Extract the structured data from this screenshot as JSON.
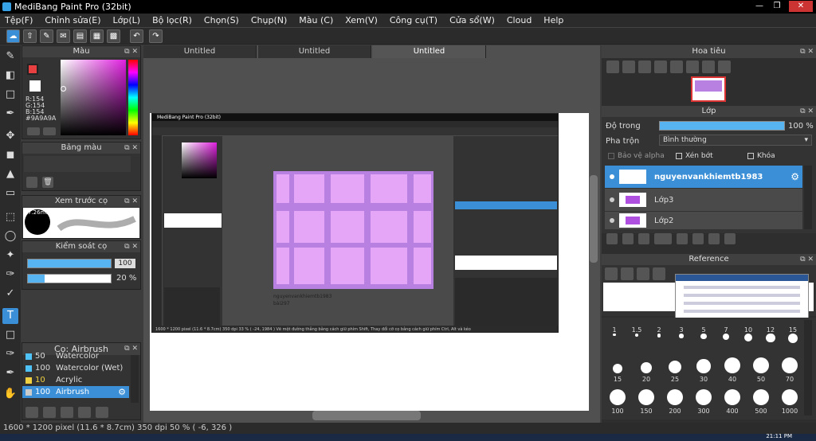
{
  "window": {
    "title": "MediBang Paint Pro (32bit)"
  },
  "menu": [
    "Tệp(F)",
    "Chỉnh sửa(E)",
    "Lớp(L)",
    "Bộ lọc(R)",
    "Chọn(S)",
    "Chụp(N)",
    "Màu (C)",
    "Xem(V)",
    "Công cụ(T)",
    "Cửa sổ(W)",
    "Cloud",
    "Help"
  ],
  "color_panel": {
    "title": "Màu",
    "r": "R:154",
    "g": "G:154",
    "b": "B:154",
    "hex": "#9A9A9A",
    "fg": "#e84040",
    "bg": "#ffffff"
  },
  "palette_panel": {
    "title": "Bảng màu"
  },
  "brush_preview": {
    "title": "Xem trước cọ",
    "size": "7.26mm"
  },
  "control_panel": {
    "title": "Kiểm soát cọ",
    "size": "100",
    "opacity": "20 %",
    "size_fraction": 1.0,
    "opacity_fraction": 0.2
  },
  "brush_list": {
    "title": "Cọ: Airbrush",
    "items": [
      {
        "size": "50",
        "name": "Watercolor",
        "color": "#4fc3f7"
      },
      {
        "size": "100",
        "name": "Watercolor (Wet)",
        "color": "#4fc3f7"
      },
      {
        "size": "10",
        "name": "Acrylic",
        "color": "#f0d040"
      },
      {
        "size": "100",
        "name": "Airbrush",
        "color": "#4fc3f7",
        "selected": true
      }
    ]
  },
  "tabs": [
    "Untitled",
    "Untitled",
    "Untitled"
  ],
  "inner_app": {
    "title": "MediBang Paint Pro (32bit)",
    "caption_line1": "nguyenvankhiemtb1983",
    "caption_line2": "bài297",
    "status": "1600 * 1200 pixel  (11.6 * 8.7cm)  350 dpi  33 %  ( -24, 1984 )  Vẽ một đường thẳng bằng cách giữ phím Shift, Thay đổi cỡ cọ bằng cách giữ phím Ctrl, Alt và kéo"
  },
  "navigator": {
    "title": "Hoa tiêu"
  },
  "layer_panel": {
    "title": "Lớp",
    "opacity_label": "Độ trong",
    "opacity_value": "100 %",
    "opacity_fraction": 1.0,
    "blend_label": "Pha trộn",
    "blend_value": "Bình thường",
    "protect_alpha": "Bảo vệ alpha",
    "clipping": "Xén bớt",
    "lock": "Khóa",
    "layers": [
      {
        "name": "nguyenvankhiemtb1983",
        "selected": true
      },
      {
        "name": "Lớp3",
        "selected": false
      },
      {
        "name": "Lớp2",
        "selected": false
      }
    ]
  },
  "reference": {
    "title": "Reference"
  },
  "brush_size": {
    "rows": [
      [
        "1",
        "1.5",
        "2",
        "3",
        "5",
        "7",
        "10",
        "12",
        "15"
      ],
      [
        "15",
        "20",
        "25",
        "30",
        "40",
        "50",
        "70"
      ],
      [
        "100",
        "150",
        "200",
        "300",
        "400",
        "500",
        "1000"
      ]
    ]
  },
  "status": {
    "text": "1600 * 1200 pixel  (11.6 * 8.7cm)  350 dpi  50 %  ( -6, 326 )"
  },
  "clock": "21:11 PM"
}
